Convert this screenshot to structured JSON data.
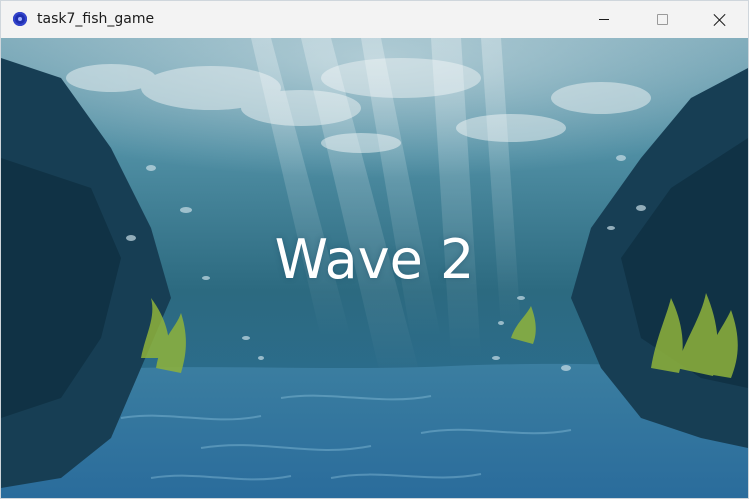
{
  "window": {
    "title": "task7_fish_game",
    "controls": {
      "minimize": "minimize",
      "maximize": "maximize",
      "close": "close"
    }
  },
  "game": {
    "wave_text": "Wave 2",
    "scene": "underwater-background"
  },
  "colors": {
    "water_top": "#6a9fb1",
    "water_mid": "#2f6f86",
    "water_bottom": "#2a6f9a",
    "rock": "#15384b",
    "seaweed": "#8fb33b",
    "text": "#ffffff"
  }
}
